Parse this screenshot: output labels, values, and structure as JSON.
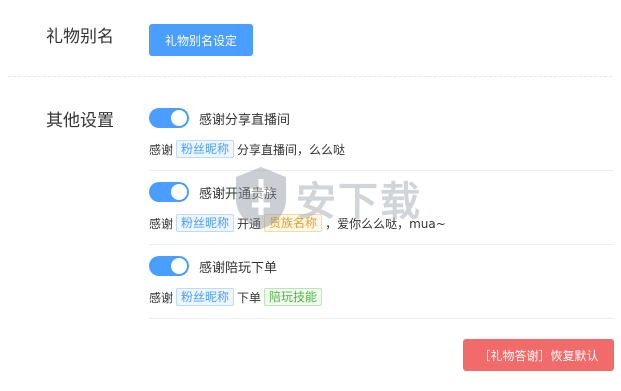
{
  "gift_alias": {
    "label": "礼物别名",
    "button": "礼物别名设定"
  },
  "other_settings": {
    "label": "其他设置",
    "items": [
      {
        "toggle_on": true,
        "title": "感谢分享直播间",
        "template": {
          "prefix": "感谢",
          "tag1": "粉丝昵称",
          "suffix": "分享直播间，么么哒"
        }
      },
      {
        "toggle_on": true,
        "title": "感谢开通贵族",
        "template": {
          "prefix": "感谢",
          "tag1": "粉丝昵称",
          "middle": "开通",
          "tag2": "贵族名称",
          "suffix": "，爱你么么哒，mua~"
        }
      },
      {
        "toggle_on": true,
        "title": "感谢陪玩下单",
        "template": {
          "prefix": "感谢",
          "tag1": "粉丝昵称",
          "middle": "下单",
          "tag2": "陪玩技能"
        }
      }
    ]
  },
  "footer": {
    "reset_button": "［礼物答谢］恢复默认"
  },
  "watermark": {
    "text": "安下载"
  },
  "colors": {
    "primary": "#4a9eff",
    "danger": "#f26b6b",
    "tag_green": "#52b44a",
    "tag_orange": "#e0a030"
  }
}
